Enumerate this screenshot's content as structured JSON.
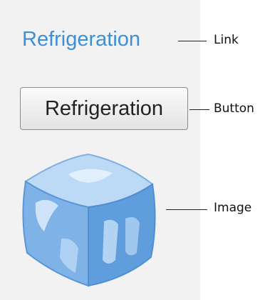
{
  "elements": {
    "link_text": "Refrigeration",
    "button_label": "Refrigeration",
    "image_icon": "ice-cube-icon"
  },
  "callouts": {
    "link": "Link",
    "button": "Button",
    "image": "Image"
  },
  "colors": {
    "panel_bg": "#f2f2f2",
    "link": "#3d8fd6",
    "ice_light": "#a9cdf2",
    "ice_dark": "#4f8fd4"
  }
}
